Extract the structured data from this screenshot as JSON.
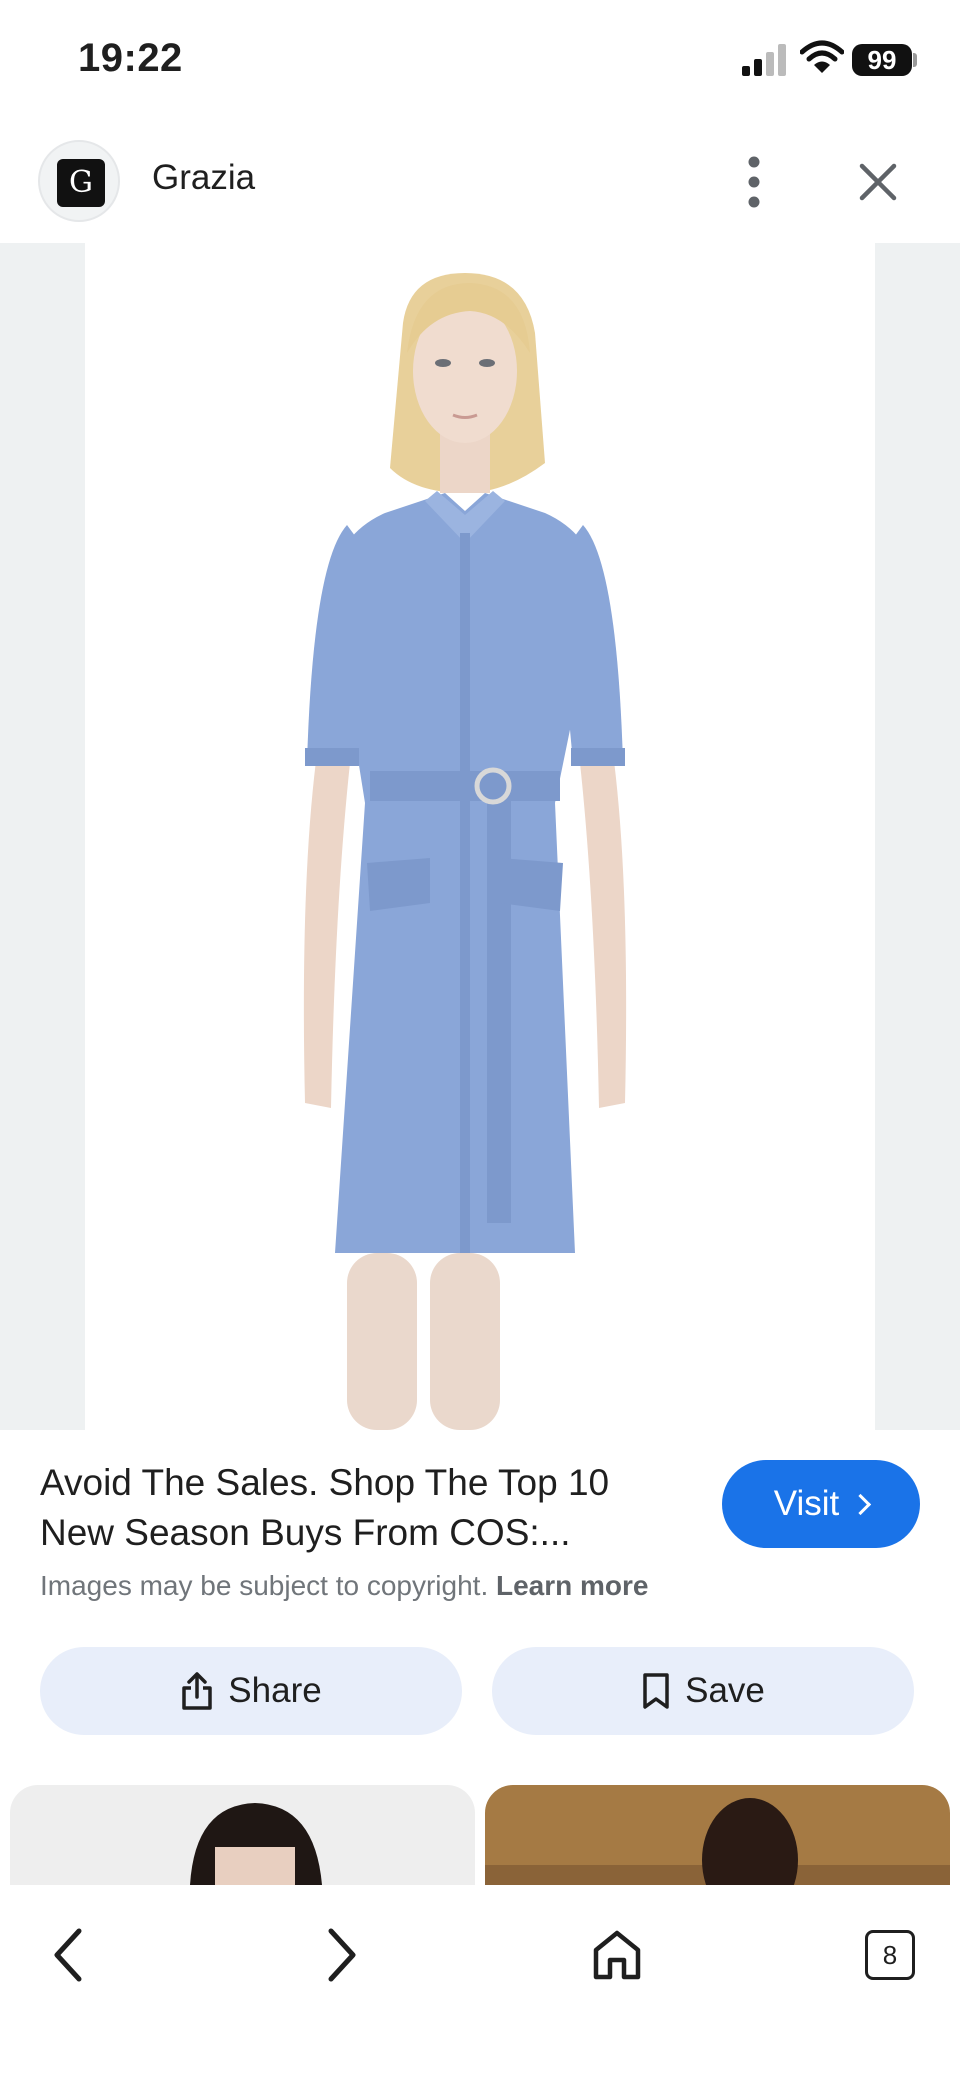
{
  "status_bar": {
    "time": "19:22",
    "battery": "99"
  },
  "source": {
    "logo_letter": "G",
    "name": "Grazia"
  },
  "result": {
    "title": "Avoid The Sales. Shop The Top 10 New Season Buys From COS:...",
    "visit_label": "Visit",
    "copyright_text": "Images may be subject to copyright.",
    "learn_more": "Learn more"
  },
  "actions": {
    "share_label": "Share",
    "save_label": "Save"
  },
  "toolbar": {
    "tab_count": "8"
  },
  "colors": {
    "accent": "#1a73e8",
    "pill_bg": "#e8eefa",
    "dress": "#8aa6d8"
  },
  "icons": [
    "signal-icon",
    "wifi-icon",
    "more-vert-icon",
    "close-icon",
    "share-icon",
    "bookmark-icon",
    "back-icon",
    "forward-icon",
    "home-icon",
    "tabs-icon"
  ]
}
